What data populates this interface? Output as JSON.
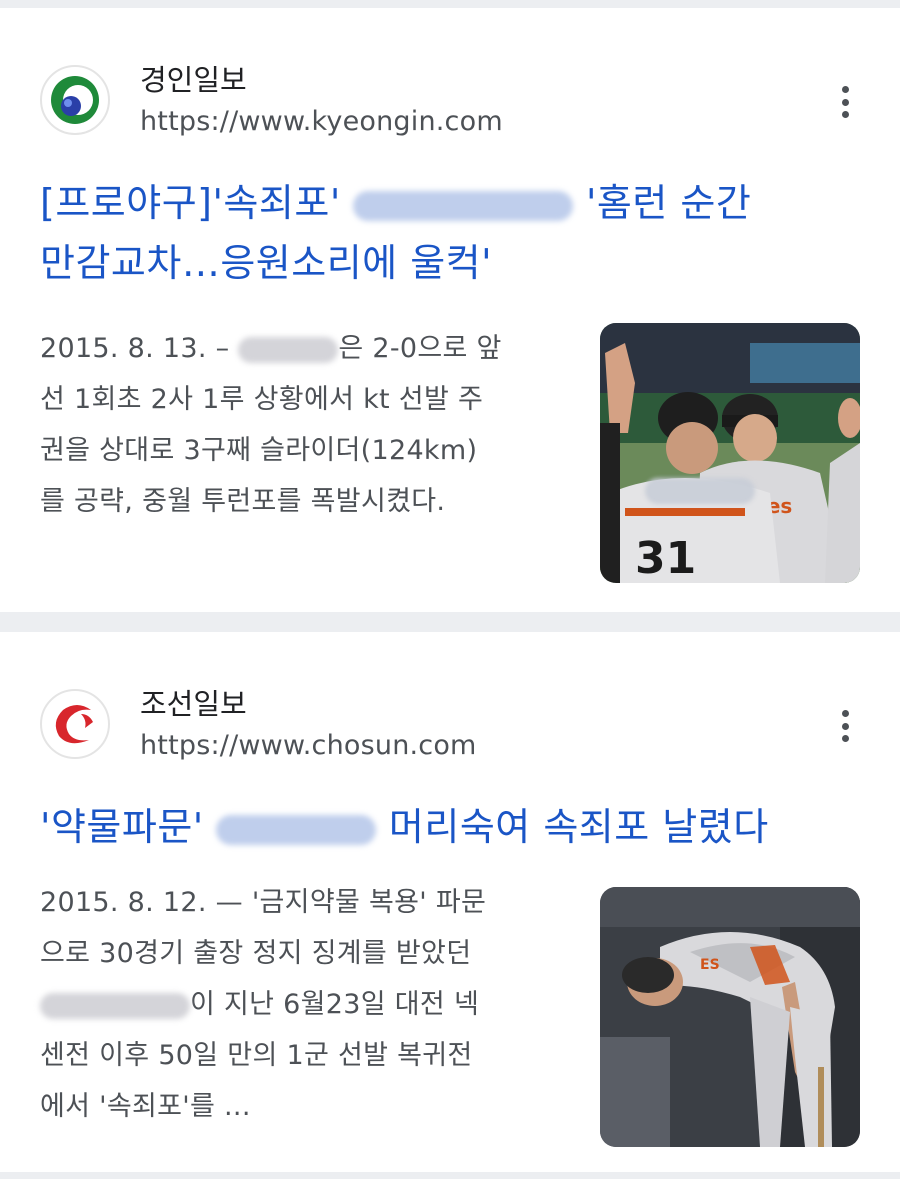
{
  "results": [
    {
      "site_name": "경인일보",
      "site_url": "https://www.kyeongin.com",
      "title_part1": "[프로야구]'속죄포'",
      "title_part2": "'홈런 순간",
      "title_line2": "만감교차…응원소리에 울컥'",
      "snippet_date": "2015. 8. 13. –",
      "snippet_l1_end": "은 2-0으로 앞",
      "snippet_l2": "선 1회초 2사 1루 상황에서 kt 선발 주",
      "snippet_l3": "권을 상대로 3구째 슬라이더(124km)",
      "snippet_l4": "를 공략, 중월 투런포를 폭발시켰다.",
      "thumb_number": "31",
      "thumb_text": "les",
      "thumb_cap": "ES"
    },
    {
      "site_name": "조선일보",
      "site_url": "https://www.chosun.com",
      "title_part1": "'약물파문'",
      "title_part2": "머리숙여 속죄포 날렸다",
      "snippet_l1": "2015. 8. 12. — '금지약물 복용' 파문",
      "snippet_l2": "으로 30경기 출장 정지 징계를 받았던",
      "snippet_l3_end": "이 지난 6월23일 대전 넥",
      "snippet_l4": "센전 이후 50일 만의 1군 선발 복귀전",
      "snippet_l5": "에서 '속죄포'를 ..."
    }
  ],
  "icons": {
    "more": "more-vert-icon",
    "logo1": "kyeongin-logo",
    "logo2": "chosun-logo"
  },
  "colors": {
    "link": "#1a55c6",
    "separator": "#eceef1",
    "text": "#4d5156"
  }
}
